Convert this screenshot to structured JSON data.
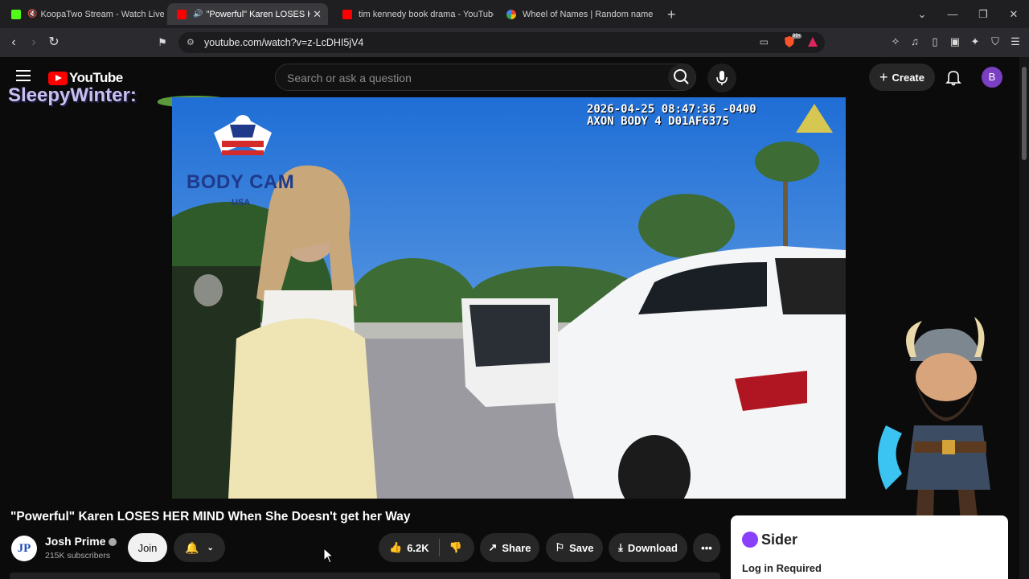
{
  "browser": {
    "tabs": [
      {
        "title": "KoopaTwo Stream - Watch Live o",
        "favicon_color": "#53fc18"
      },
      {
        "title": "\"Powerful\" Karen LOSES HER I",
        "favicon_color": "#ff0000"
      },
      {
        "title": "tim kennedy book drama - YouTube",
        "favicon_color": "#ff0000"
      },
      {
        "title": "Wheel of Names | Random name pic",
        "favicon_color": "#4285f4"
      }
    ],
    "new_tab": "+",
    "url": "youtube.com/watch?v=z-LcDHI5jV4",
    "brave_badge": "99+"
  },
  "youtube": {
    "logo_text": "YouTube",
    "search_placeholder": "Search or ask a question",
    "create_label": "Create",
    "avatar_letter": "B"
  },
  "stream_overlay": {
    "username": "SleepyWinter:"
  },
  "video": {
    "timestamp_line1": "2026-04-25 08:47:36 -0400",
    "timestamp_line2": "AXON BODY 4 D01AF6375",
    "watermark": "BODY CAM",
    "watermark_sub": "USA",
    "title": "\"Powerful\" Karen LOSES HER MIND When She Doesn't get her Way"
  },
  "channel": {
    "avatar_text": "JP",
    "name": "Josh Prime",
    "subscribers": "215K subscribers",
    "join_label": "Join"
  },
  "actions": {
    "likes": "6.2K",
    "share_label": "Share",
    "save_label": "Save",
    "download_label": "Download"
  },
  "sider": {
    "name": "Sider",
    "login_text": "Log in Required"
  }
}
